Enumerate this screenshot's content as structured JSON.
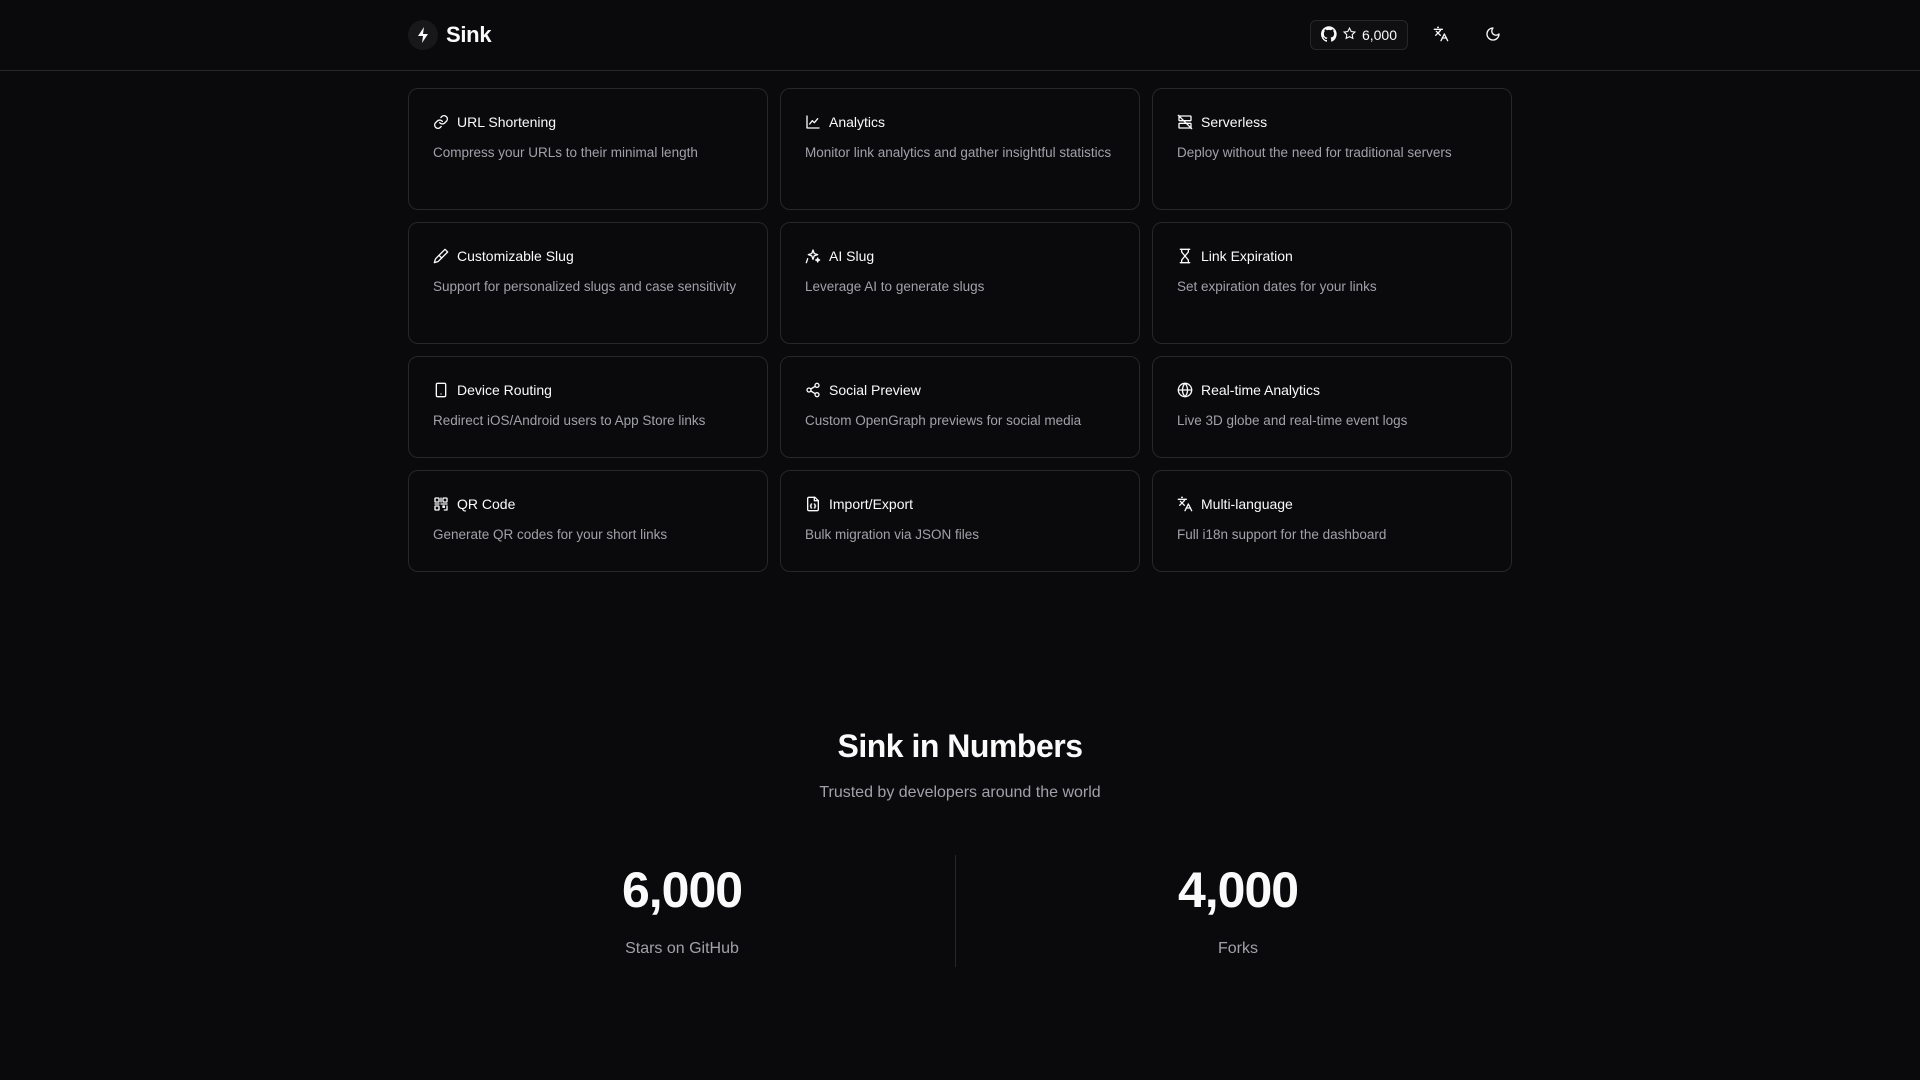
{
  "header": {
    "brand": "Sink",
    "github_stars": "6,000"
  },
  "features": [
    {
      "title": "URL Shortening",
      "desc": "Compress your URLs to their minimal length",
      "icon": "link-icon"
    },
    {
      "title": "Analytics",
      "desc": "Monitor link analytics and gather insightful statistics",
      "icon": "chart-icon"
    },
    {
      "title": "Serverless",
      "desc": "Deploy without the need for traditional servers",
      "icon": "server-off-icon"
    },
    {
      "title": "Customizable Slug",
      "desc": "Support for personalized slugs and case sensitivity",
      "icon": "paintbrush-icon"
    },
    {
      "title": "AI Slug",
      "desc": "Leverage AI to generate slugs",
      "icon": "sparkles-icon"
    },
    {
      "title": "Link Expiration",
      "desc": "Set expiration dates for your links",
      "icon": "hourglass-icon"
    },
    {
      "title": "Device Routing",
      "desc": "Redirect iOS/Android users to App Store links",
      "icon": "smartphone-icon"
    },
    {
      "title": "Social Preview",
      "desc": "Custom OpenGraph previews for social media",
      "icon": "share-icon"
    },
    {
      "title": "Real-time Analytics",
      "desc": "Live 3D globe and real-time event logs",
      "icon": "globe-icon"
    },
    {
      "title": "QR Code",
      "desc": "Generate QR codes for your short links",
      "icon": "qr-code-icon"
    },
    {
      "title": "Import/Export",
      "desc": "Bulk migration via JSON files",
      "icon": "file-json-icon"
    },
    {
      "title": "Multi-language",
      "desc": "Full i18n support for the dashboard",
      "icon": "languages-icon"
    }
  ],
  "stats": {
    "title": "Sink in Numbers",
    "subtitle": "Trusted by developers around the world",
    "items": [
      {
        "value": "6,000",
        "label": "Stars on GitHub"
      },
      {
        "value": "4,000",
        "label": "Forks"
      }
    ]
  }
}
